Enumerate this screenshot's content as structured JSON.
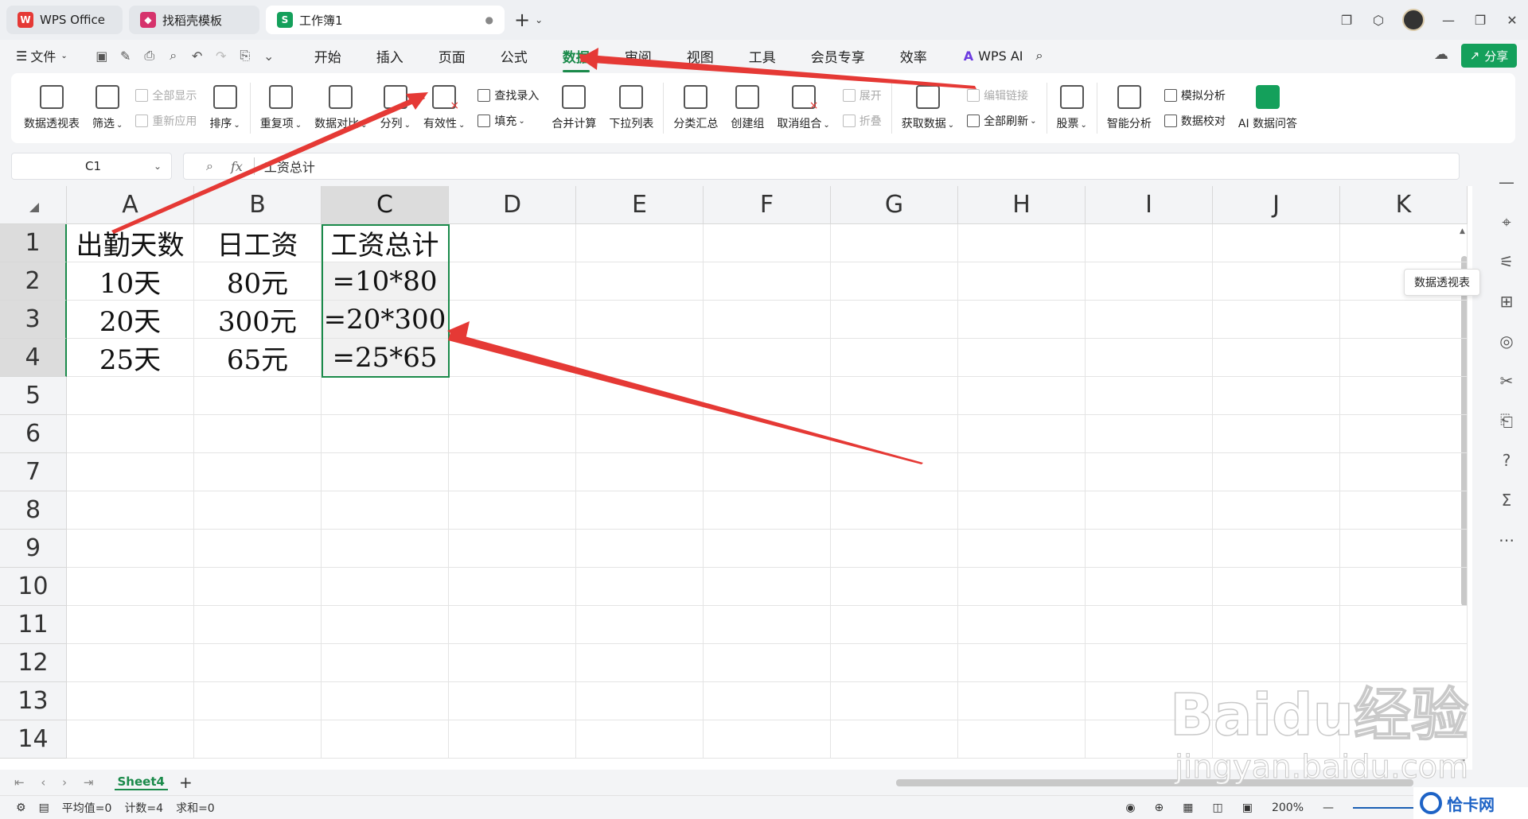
{
  "titlebar": {
    "tabs": [
      {
        "label": "WPS Office"
      },
      {
        "label": "找稻壳模板"
      },
      {
        "label": "工作簿1"
      }
    ]
  },
  "menubar": {
    "file": "文件",
    "tabs": [
      "开始",
      "插入",
      "页面",
      "公式",
      "数据",
      "审阅",
      "视图",
      "工具",
      "会员专享",
      "效率"
    ],
    "active_tab": "数据",
    "wps_ai": "WPS AI",
    "share": "分享"
  },
  "ribbon": {
    "pivot": "数据透视表",
    "filter": "筛选",
    "show_all": "全部显示",
    "reapply": "重新应用",
    "sort": "排序",
    "duplicates": "重复项",
    "compare": "数据对比",
    "split": "分列",
    "validity": "有效性",
    "lookup": "查找录入",
    "fill": "填充",
    "consolidate": "合并计算",
    "dropdown": "下拉列表",
    "subtotal": "分类汇总",
    "group": "创建组",
    "ungroup": "取消组合",
    "expand": "展开",
    "collapse": "折叠",
    "get_data": "获取数据",
    "edit_links": "编辑链接",
    "refresh_all": "全部刷新",
    "stocks": "股票",
    "smart_analysis": "智能分析",
    "simulate": "模拟分析",
    "verify": "数据校对",
    "ai_qa": "AI 数据问答"
  },
  "formula": {
    "cell_ref": "C1",
    "fx": "fx",
    "content": "工资总计"
  },
  "grid": {
    "columns": [
      "A",
      "B",
      "C",
      "D",
      "E",
      "F",
      "G",
      "H",
      "I",
      "J",
      "K"
    ],
    "rows": [
      "1",
      "2",
      "3",
      "4",
      "5",
      "6",
      "7",
      "8",
      "9",
      "10",
      "11",
      "12",
      "13",
      "14"
    ],
    "cells": [
      [
        "出勤天数",
        "日工资",
        "工资总计"
      ],
      [
        "10天",
        "80元",
        "=10*80"
      ],
      [
        "20天",
        "300元",
        "=20*300"
      ],
      [
        "25天",
        "65元",
        "=25*65"
      ]
    ]
  },
  "tooltip": "数据透视表",
  "sheets": {
    "active": "Sheet4"
  },
  "status": {
    "average": "平均值=0",
    "count": "计数=4",
    "sum": "求和=0",
    "zoom": "200%"
  },
  "watermark": {
    "brand": "Baidu经验",
    "url": "jingyan.baidu.com",
    "corner_logo": "恰卡网"
  },
  "colors": {
    "accent": "#1a8a4a",
    "arrow": "#e53935",
    "share_button": "#14a05b"
  }
}
